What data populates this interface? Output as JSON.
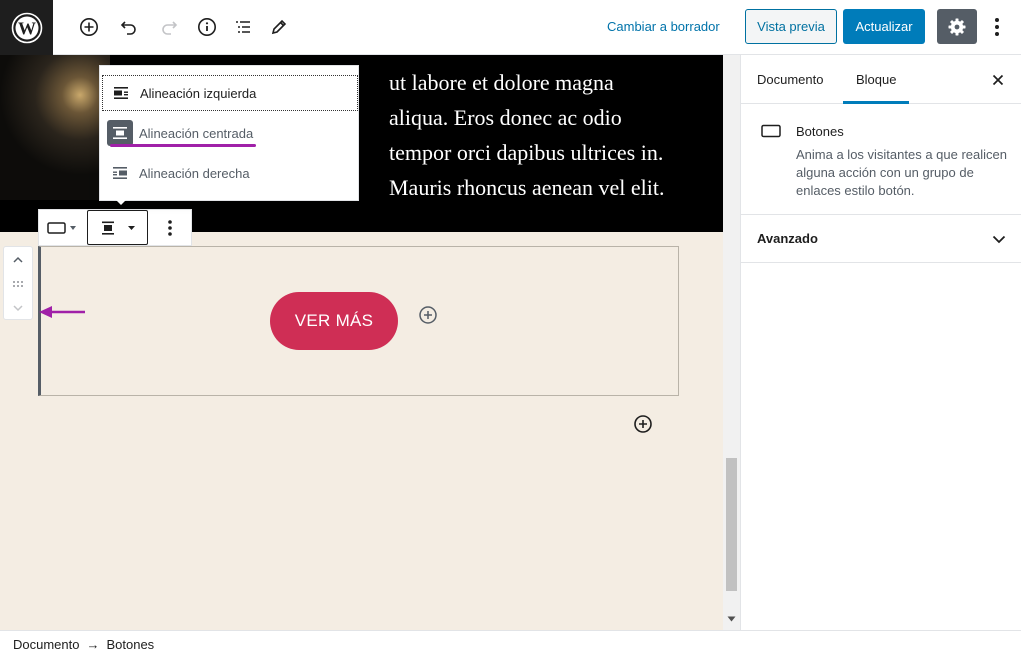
{
  "topbar": {
    "switch_to_draft": "Cambiar a borrador",
    "preview_label": "Vista previa",
    "update_label": "Actualizar"
  },
  "cover": {
    "lines": [
      "ut labore et dolore magna",
      "aliqua. Eros donec ac odio",
      "tempor orci dapibus ultrices in.",
      "Mauris rhoncus aenean vel elit."
    ]
  },
  "alignment_menu": {
    "items": [
      {
        "label": "Alineación izquierda",
        "icon": "align-left-icon"
      },
      {
        "label": "Alineación centrada",
        "icon": "align-center-icon"
      },
      {
        "label": "Alineación derecha",
        "icon": "align-right-icon"
      }
    ]
  },
  "buttons_block": {
    "button_label": "VER MÁS",
    "button_color": "#cf2e55"
  },
  "sidebar": {
    "tabs": [
      "Documento",
      "Bloque"
    ],
    "active_tab": "Bloque",
    "block_card": {
      "title": "Botones",
      "description": "Anima a los visitantes a que realicen alguna acción con un grupo de enlaces estilo botón."
    },
    "panels": [
      {
        "label": "Avanzado"
      }
    ]
  },
  "breadcrumb": {
    "items": [
      "Documento",
      "Botones"
    ],
    "separator": "→"
  },
  "colors": {
    "accent": "#007cba",
    "annotation": "#a020a8",
    "canvas_bg": "#f4ede3"
  }
}
